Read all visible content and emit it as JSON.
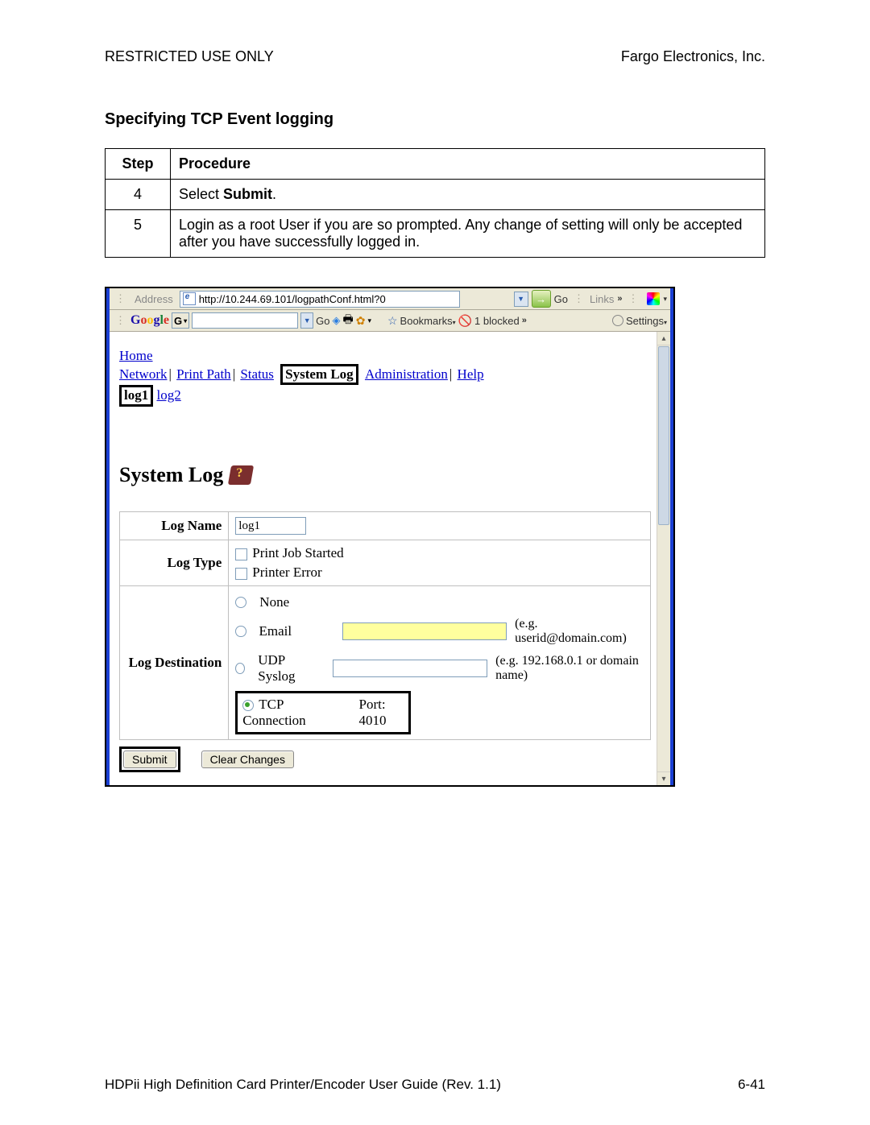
{
  "header": {
    "left": "RESTRICTED USE ONLY",
    "right": "Fargo Electronics, Inc."
  },
  "section_title": "Specifying TCP Event logging",
  "proc": {
    "headers": {
      "step": "Step",
      "procedure": "Procedure"
    },
    "rows": [
      {
        "step": "4",
        "text_a": "Select ",
        "text_b": "Submit",
        "text_c": "."
      },
      {
        "step": "5",
        "text": "Login as a root User if you are so prompted. Any change of setting will only be accepted after you have successfully logged in."
      }
    ]
  },
  "browser": {
    "address_label": "Address",
    "url": "http://10.244.69.101/logpathConf.html?0",
    "go": "Go",
    "links": "Links",
    "google": "Google",
    "go2": "Go",
    "bookmarks": "Bookmarks",
    "blocked": "1 blocked",
    "settings": "Settings"
  },
  "nav": {
    "home": "Home",
    "network": "Network",
    "print_path": "Print Path",
    "status": "Status",
    "system_log": "System Log",
    "administration": "Administration",
    "help": "Help",
    "log1": "log1",
    "log2": "log2"
  },
  "page": {
    "title": "System Log",
    "log_name_label": "Log Name",
    "log_name_value": "log1",
    "log_type_label": "Log Type",
    "log_type_opts": {
      "a": "Print Job Started",
      "b": "Printer Error"
    },
    "log_dest_label": "Log Destination",
    "dest": {
      "none": "None",
      "email": "Email",
      "email_hint": "(e.g. userid@domain.com)",
      "udp": "UDP Syslog",
      "udp_hint": "(e.g. 192.168.0.1 or domain name)",
      "tcp": "TCP Connection",
      "port": "Port: 4010"
    },
    "submit": "Submit",
    "clear": "Clear Changes"
  },
  "footer": {
    "left": "HDPii High Definition Card Printer/Encoder User Guide (Rev. 1.1)",
    "right": "6-41"
  }
}
